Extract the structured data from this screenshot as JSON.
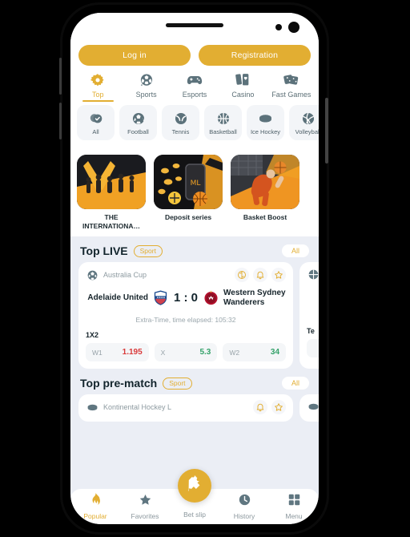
{
  "device": {
    "frame": "smartphone",
    "speaker": "earpiece-speaker",
    "cameras": 2
  },
  "colors": {
    "accent": "#e2ae32",
    "screen_bg": "#ebeef5",
    "card_bg": "#ffffff",
    "muted_text": "#8d9aa0",
    "odd_up": "#35a26a",
    "odd_down": "#d93a3a"
  },
  "auth": {
    "login": "Log in",
    "registration": "Registration"
  },
  "main_nav": [
    {
      "label": "Top",
      "icon": "gear-icon",
      "active": true
    },
    {
      "label": "Sports",
      "icon": "football-icon",
      "active": false
    },
    {
      "label": "Esports",
      "icon": "gamepad-icon",
      "active": false
    },
    {
      "label": "Casino",
      "icon": "cards-icon",
      "active": false
    },
    {
      "label": "Fast Games",
      "icon": "dice-icon",
      "active": false
    }
  ],
  "sport_chips": [
    {
      "label": "All",
      "icon": "check-circle-icon"
    },
    {
      "label": "Football",
      "icon": "football-icon"
    },
    {
      "label": "Tennis",
      "icon": "tennis-ball-icon"
    },
    {
      "label": "Basketball",
      "icon": "basketball-icon"
    },
    {
      "label": "Ice Hockey",
      "icon": "hockey-puck-icon"
    },
    {
      "label": "Volleyball",
      "icon": "volleyball-icon"
    }
  ],
  "promos": [
    {
      "caption": "THE INTERNATIONA…",
      "image": "dota-international-banner"
    },
    {
      "caption": "Deposit series",
      "image": "deposit-series-banner"
    },
    {
      "caption": "Basket Boost",
      "image": "basket-boost-banner"
    }
  ],
  "live_section": {
    "title": "Top LIVE",
    "badge": "Sport",
    "all_label": "All",
    "match": {
      "league": "Australia Cup",
      "league_icon": "football-icon",
      "actions": [
        "stats-icon",
        "bell-icon",
        "star-icon"
      ],
      "home_team": "Adelaide United",
      "away_team": "Western Sydney Wanderers",
      "score": "1 : 0",
      "status": "Extra-Time, time elapsed: 105:32",
      "market": "1X2",
      "odds": [
        {
          "label": "W1",
          "value": "1.195",
          "trend": "down"
        },
        {
          "label": "X",
          "value": "5.3",
          "trend": "up"
        },
        {
          "label": "W2",
          "value": "34",
          "trend": "up"
        }
      ]
    },
    "next_card": {
      "market": "Te",
      "league_icon": "basketball-icon"
    }
  },
  "prematch_section": {
    "title": "Top pre-match",
    "badge": "Sport",
    "all_label": "All",
    "match": {
      "league": "Kontinental Hockey L",
      "league_icon": "hockey-puck-icon",
      "actions": [
        "bell-icon",
        "star-icon"
      ]
    }
  },
  "bottom_nav": [
    {
      "label": "Popular",
      "icon": "flame-icon",
      "active": true
    },
    {
      "label": "Favorites",
      "icon": "star-icon",
      "active": false
    },
    {
      "label": "Bet slip",
      "icon": "ticket-icon",
      "active": false
    },
    {
      "label": "History",
      "icon": "clock-icon",
      "active": false
    },
    {
      "label": "Menu",
      "icon": "grid-icon",
      "active": false
    }
  ]
}
